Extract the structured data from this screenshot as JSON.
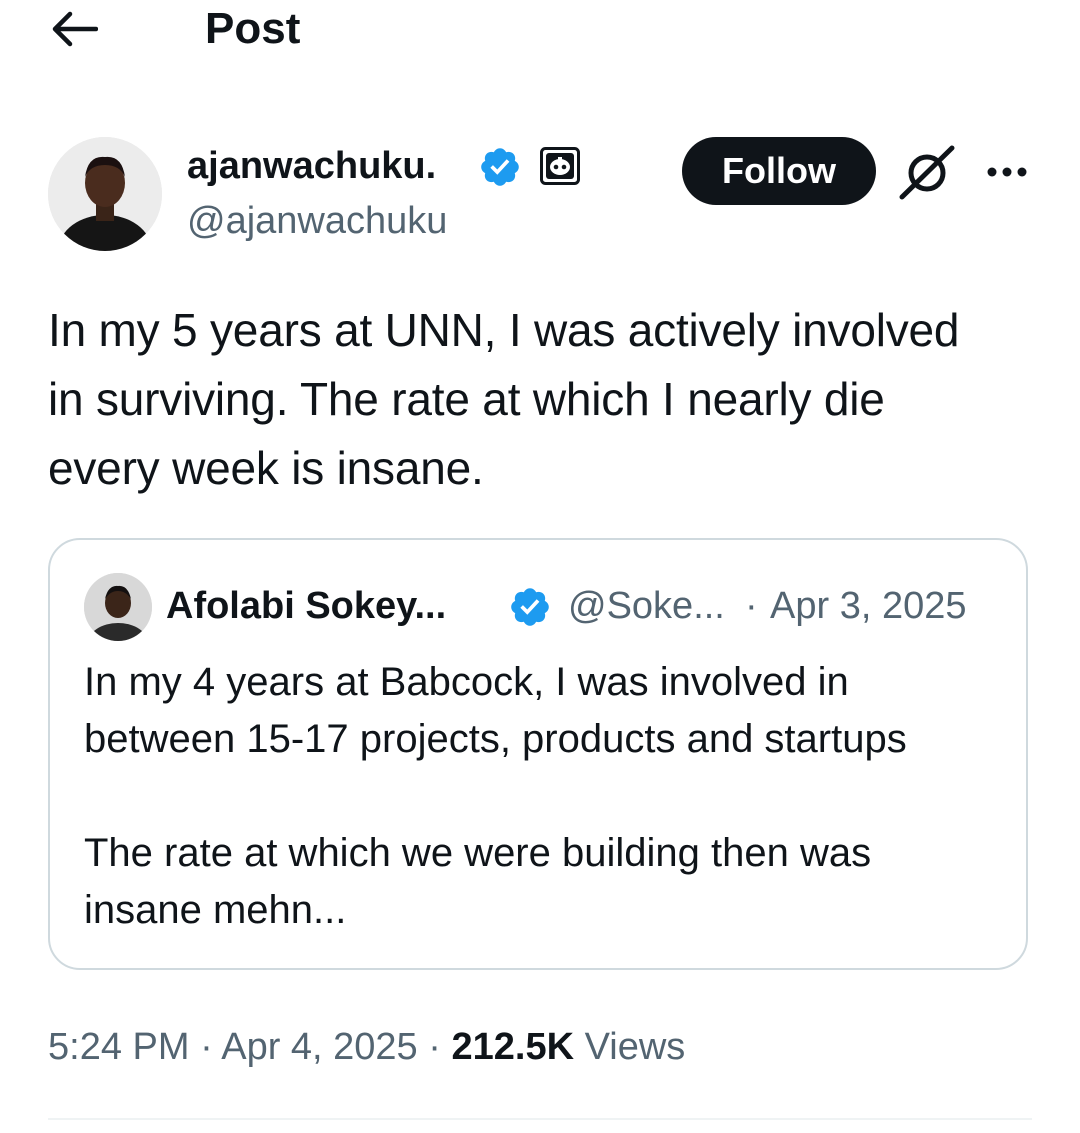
{
  "header": {
    "title": "Post",
    "back_icon": "arrow-left-icon"
  },
  "author": {
    "name": "ajanwachuku.",
    "handle": "@ajanwachuku",
    "verified": true,
    "follow_label": "Follow"
  },
  "post": {
    "text": "In my 5 years at UNN, I was actively involved\nin surviving. The rate at which I nearly die\nevery week is insane."
  },
  "quote": {
    "name": "Afolabi Sokey...",
    "handle": "@Soke...",
    "separator": "·",
    "date": "Apr 3, 2025",
    "verified": true,
    "text": "In my 4 years at Babcock, I was involved in\nbetween 15-17 projects, products and startups\n\nThe rate at which we were building then was\ninsane mehn..."
  },
  "meta": {
    "time": "5:24 PM",
    "date": "Apr 4, 2025",
    "separator": " · ",
    "views_count": "212.5K",
    "views_label": "Views"
  },
  "colors": {
    "verified_blue": "#1d9bf0",
    "text_primary": "#0f1419",
    "text_secondary": "#536471",
    "border": "#cfd9de"
  }
}
